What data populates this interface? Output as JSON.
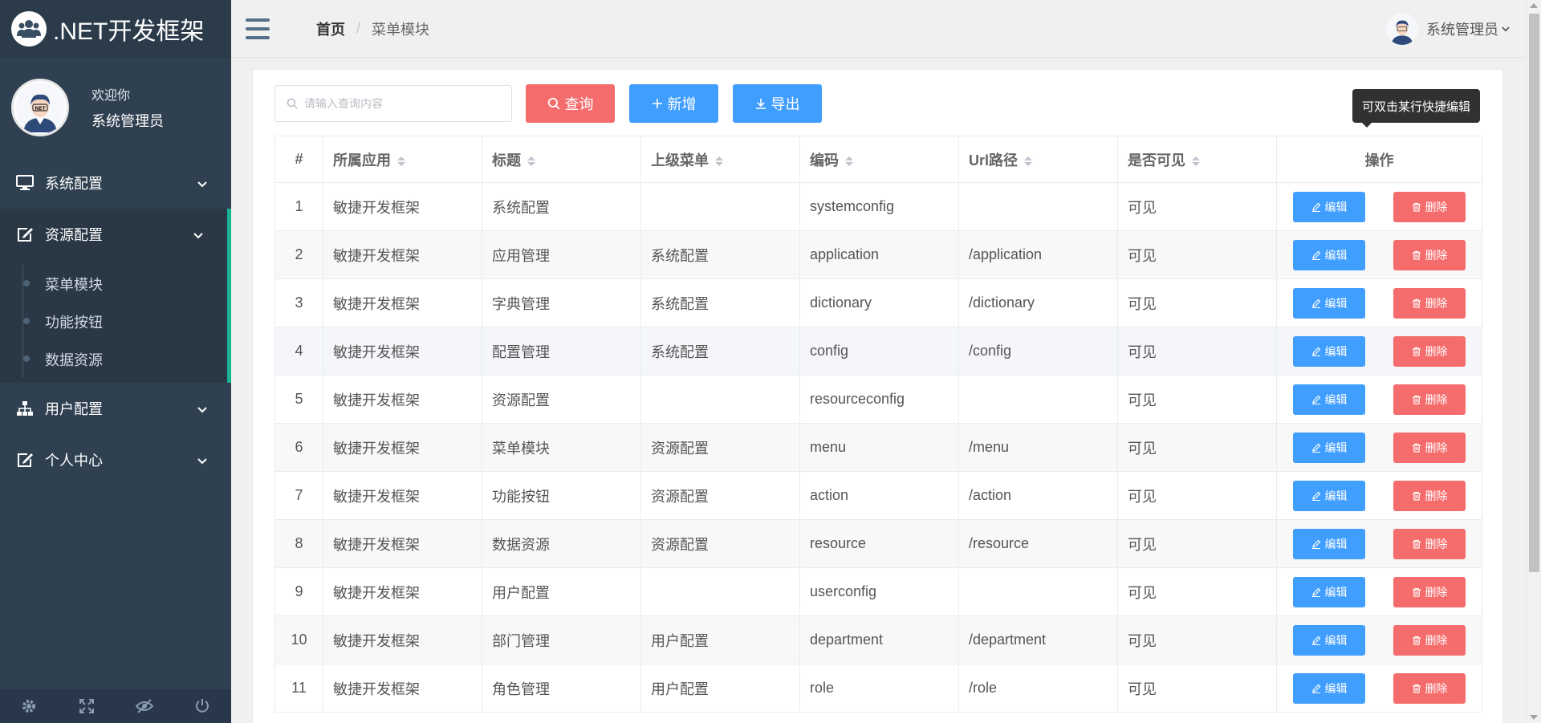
{
  "brand": {
    "title": ".NET开发框架"
  },
  "profile": {
    "welcome": "欢迎你",
    "name": "系统管理员",
    "avatar_text": "NET"
  },
  "sidebar": {
    "menus": [
      {
        "label": "系统配置",
        "icon": "monitor-icon"
      },
      {
        "label": "资源配置",
        "icon": "edit-icon",
        "active": true
      },
      {
        "label": "用户配置",
        "icon": "sitemap-icon"
      },
      {
        "label": "个人中心",
        "icon": "edit-icon"
      }
    ],
    "submenu": [
      "菜单模块",
      "功能按钮",
      "数据资源"
    ],
    "footer_icons": [
      "gear-icon",
      "fullscreen-icon",
      "eye-off-icon",
      "power-icon"
    ]
  },
  "header": {
    "breadcrumb_home": "首页",
    "breadcrumb_sep": "/",
    "breadcrumb_current": "菜单模块",
    "user_name": "系统管理员"
  },
  "toolbar": {
    "search_placeholder": "请输入查询内容",
    "query_label": "查询",
    "add_label": "新增",
    "export_label": "导出",
    "tooltip": "可双击某行快捷编辑"
  },
  "table": {
    "columns": [
      "#",
      "所属应用",
      "标题",
      "上级菜单",
      "编码",
      "Url路径",
      "是否可见",
      "操作"
    ],
    "edit_label": "编辑",
    "delete_label": "删除",
    "rows": [
      [
        "1",
        "敏捷开发框架",
        "系统配置",
        "",
        "systemconfig",
        "",
        "可见"
      ],
      [
        "2",
        "敏捷开发框架",
        "应用管理",
        "系统配置",
        "application",
        "/application",
        "可见"
      ],
      [
        "3",
        "敏捷开发框架",
        "字典管理",
        "系统配置",
        "dictionary",
        "/dictionary",
        "可见"
      ],
      [
        "4",
        "敏捷开发框架",
        "配置管理",
        "系统配置",
        "config",
        "/config",
        "可见"
      ],
      [
        "5",
        "敏捷开发框架",
        "资源配置",
        "",
        "resourceconfig",
        "",
        "可见"
      ],
      [
        "6",
        "敏捷开发框架",
        "菜单模块",
        "资源配置",
        "menu",
        "/menu",
        "可见"
      ],
      [
        "7",
        "敏捷开发框架",
        "功能按钮",
        "资源配置",
        "action",
        "/action",
        "可见"
      ],
      [
        "8",
        "敏捷开发框架",
        "数据资源",
        "资源配置",
        "resource",
        "/resource",
        "可见"
      ],
      [
        "9",
        "敏捷开发框架",
        "用户配置",
        "",
        "userconfig",
        "",
        "可见"
      ],
      [
        "10",
        "敏捷开发框架",
        "部门管理",
        "用户配置",
        "department",
        "/department",
        "可见"
      ],
      [
        "11",
        "敏捷开发框架",
        "角色管理",
        "用户配置",
        "role",
        "/role",
        "可见"
      ]
    ]
  },
  "colors": {
    "sidebar": "#2f4050",
    "accent": "#1ab394",
    "primary": "#409eff",
    "danger": "#f56c6c"
  }
}
